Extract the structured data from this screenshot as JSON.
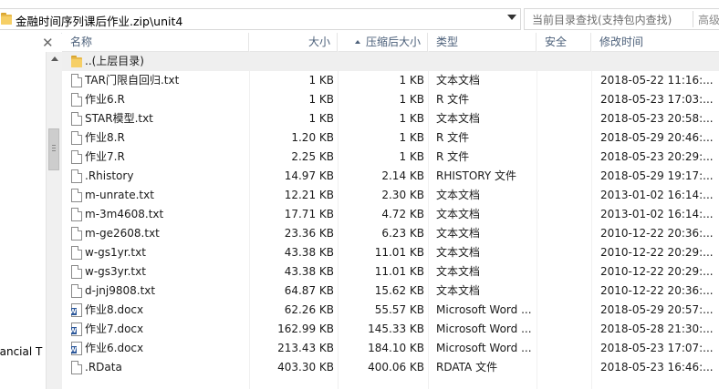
{
  "address": {
    "path": "金融时间序列课后作业.zip\\unit4",
    "search_placeholder": "当前目录查找(支持包内查找)",
    "advanced_label": "高级"
  },
  "left_pane": {
    "tree_label": "nancial T"
  },
  "columns": {
    "name": "名称",
    "size": "大小",
    "compressed": "压缩后大小",
    "type": "类型",
    "security": "安全",
    "modified": "修改时间"
  },
  "rows": [
    {
      "name": "..(上层目录)",
      "icon": "folder-icon",
      "size": "",
      "compressed": "",
      "type": "",
      "modified": ""
    },
    {
      "name": "TAR门限自回归.txt",
      "icon": "text-file-icon",
      "size": "1 KB",
      "compressed": "1 KB",
      "type": "文本文档",
      "modified": "2018-05-22 11:16:..."
    },
    {
      "name": "作业6.R",
      "icon": "text-file-icon",
      "size": "1 KB",
      "compressed": "1 KB",
      "type": "R 文件",
      "modified": "2018-05-23 17:03:..."
    },
    {
      "name": "STAR模型.txt",
      "icon": "text-file-icon",
      "size": "1 KB",
      "compressed": "1 KB",
      "type": "文本文档",
      "modified": "2018-05-23 20:58:..."
    },
    {
      "name": "作业8.R",
      "icon": "text-file-icon",
      "size": "1.20 KB",
      "compressed": "1 KB",
      "type": "R 文件",
      "modified": "2018-05-29 20:46:..."
    },
    {
      "name": "作业7.R",
      "icon": "text-file-icon",
      "size": "2.25 KB",
      "compressed": "1 KB",
      "type": "R 文件",
      "modified": "2018-05-23 20:29:..."
    },
    {
      "name": ".Rhistory",
      "icon": "text-file-icon",
      "size": "14.97 KB",
      "compressed": "2.14 KB",
      "type": "RHISTORY 文件",
      "modified": "2018-05-29 19:17:..."
    },
    {
      "name": "m-unrate.txt",
      "icon": "text-file-icon",
      "size": "12.21 KB",
      "compressed": "2.30 KB",
      "type": "文本文档",
      "modified": "2013-01-02 16:14:..."
    },
    {
      "name": "m-3m4608.txt",
      "icon": "text-file-icon",
      "size": "17.71 KB",
      "compressed": "4.72 KB",
      "type": "文本文档",
      "modified": "2013-01-02 16:14:..."
    },
    {
      "name": "m-ge2608.txt",
      "icon": "text-file-icon",
      "size": "23.36 KB",
      "compressed": "6.23 KB",
      "type": "文本文档",
      "modified": "2010-12-22 20:36:..."
    },
    {
      "name": "w-gs1yr.txt",
      "icon": "text-file-icon",
      "size": "43.38 KB",
      "compressed": "11.01 KB",
      "type": "文本文档",
      "modified": "2010-12-22 20:29:..."
    },
    {
      "name": "w-gs3yr.txt",
      "icon": "text-file-icon",
      "size": "43.38 KB",
      "compressed": "11.01 KB",
      "type": "文本文档",
      "modified": "2010-12-22 20:29:..."
    },
    {
      "name": "d-jnj9808.txt",
      "icon": "text-file-icon",
      "size": "64.87 KB",
      "compressed": "15.62 KB",
      "type": "文本文档",
      "modified": "2010-12-22 20:36:..."
    },
    {
      "name": "作业8.docx",
      "icon": "word-doc-icon",
      "size": "62.26 KB",
      "compressed": "55.57 KB",
      "type": "Microsoft Word ...",
      "modified": "2018-05-29 20:57:..."
    },
    {
      "name": "作业7.docx",
      "icon": "word-doc-icon",
      "size": "162.99 KB",
      "compressed": "145.33 KB",
      "type": "Microsoft Word ...",
      "modified": "2018-05-28 21:30:..."
    },
    {
      "name": "作业6.docx",
      "icon": "word-doc-icon",
      "size": "213.43 KB",
      "compressed": "184.10 KB",
      "type": "Microsoft Word ...",
      "modified": "2018-05-23 17:07:..."
    },
    {
      "name": ".RData",
      "icon": "text-file-icon",
      "size": "403.30 KB",
      "compressed": "400.06 KB",
      "type": "RDATA 文件",
      "modified": "2018-05-23 16:46:..."
    }
  ]
}
